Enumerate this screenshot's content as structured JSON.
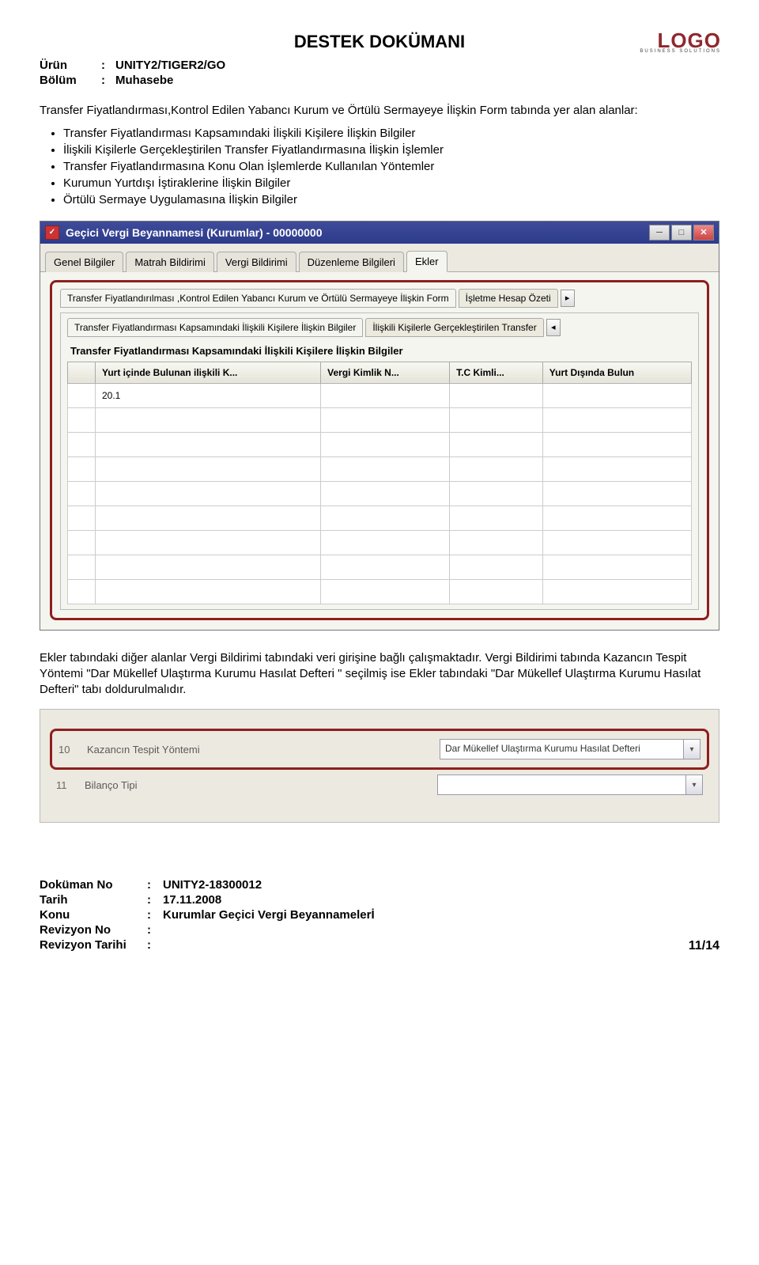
{
  "doc": {
    "title": "DESTEK DOKÜMANI",
    "product_label": "Ürün",
    "product_value": "UNITY2/TIGER2/GO",
    "section_label": "Bölüm",
    "section_value": "Muhasebe"
  },
  "logo": {
    "main": "LOGO",
    "sub": "BUSINESS SOLUTIONS"
  },
  "intro": "Transfer Fiyatlandırması,Kontrol Edilen Yabancı Kurum ve Örtülü Sermayeye İlişkin Form tabında yer alan alanlar:",
  "bullets": [
    "Transfer Fiyatlandırması Kapsamındaki İlişkili Kişilere İlişkin Bilgiler",
    "İlişkili Kişilerle Gerçekleştirilen Transfer Fiyatlandırmasına İlişkin İşlemler",
    "Transfer Fiyatlandırmasına Konu Olan İşlemlerde Kullanılan Yöntemler",
    "Kurumun Yurtdışı İştiraklerine İlişkin Bilgiler",
    "Örtülü Sermaye Uygulamasına İlişkin Bilgiler"
  ],
  "window": {
    "title": "Geçici Vergi Beyannamesi (Kurumlar) - 00000000",
    "tabs": [
      "Genel Bilgiler",
      "Matrah Bildirimi",
      "Vergi Bildirimi",
      "Düzenleme Bilgileri",
      "Ekler"
    ],
    "active_tab": "Ekler",
    "subtabs_row1": {
      "left": "Transfer Fiyatlandırılması ,Kontrol Edilen Yabancı Kurum ve Örtülü Sermayeye İlişkin Form",
      "right": "İşletme Hesap Özeti"
    },
    "subtabs_row2": {
      "left": "Transfer Fiyatlandırması Kapsamındaki İlişkili Kişilere İlişkin Bilgiler",
      "right": "İlişkili Kişilerle Gerçekleştirilen Transfer"
    },
    "section_heading": "Transfer Fiyatlandırması Kapsamındaki İlişkili Kişilere İlişkin Bilgiler",
    "columns": [
      "Yurt içinde Bulunan ilişkili K...",
      "Vergi Kimlik N...",
      "T.C Kimli...",
      "Yurt Dışında Bulun"
    ],
    "rows": [
      {
        "c0": "20.1",
        "c1": "",
        "c2": "",
        "c3": ""
      },
      {
        "c0": "",
        "c1": "",
        "c2": "",
        "c3": ""
      },
      {
        "c0": "",
        "c1": "",
        "c2": "",
        "c3": ""
      },
      {
        "c0": "",
        "c1": "",
        "c2": "",
        "c3": ""
      },
      {
        "c0": "",
        "c1": "",
        "c2": "",
        "c3": ""
      },
      {
        "c0": "",
        "c1": "",
        "c2": "",
        "c3": ""
      },
      {
        "c0": "",
        "c1": "",
        "c2": "",
        "c3": ""
      },
      {
        "c0": "",
        "c1": "",
        "c2": "",
        "c3": ""
      },
      {
        "c0": "",
        "c1": "",
        "c2": "",
        "c3": ""
      }
    ]
  },
  "body_text": "Ekler tabındaki diğer alanlar Vergi Bildirimi tabındaki veri girişine bağlı çalışmaktadır. Vergi Bildirimi tabında Kazancın Tespit Yöntemi \"Dar Mükellef Ulaştırma Kurumu Hasılat Defteri \" seçilmiş ise Ekler tabındaki \"Dar Mükellef Ulaştırma Kurumu Hasılat Defteri\" tabı doldurulmalıdır.",
  "form": {
    "row1": {
      "num": "10",
      "label": "Kazancın Tespit Yöntemi",
      "value": "Dar Mükellef Ulaştırma Kurumu Hasılat Defteri"
    },
    "row2": {
      "num": "11",
      "label": "Bilanço Tipi",
      "value": ""
    }
  },
  "footer": {
    "docno_label": "Doküman No",
    "docno_value": "UNITY2-18300012",
    "date_label": "Tarih",
    "date_value": "17.11.2008",
    "topic_label": "Konu",
    "topic_value": "Kurumlar Geçici Vergi Beyannamelerİ",
    "revno_label": "Revizyon No",
    "revno_value": "",
    "revdate_label": "Revizyon Tarihi",
    "revdate_value": "",
    "page": "11/14"
  }
}
